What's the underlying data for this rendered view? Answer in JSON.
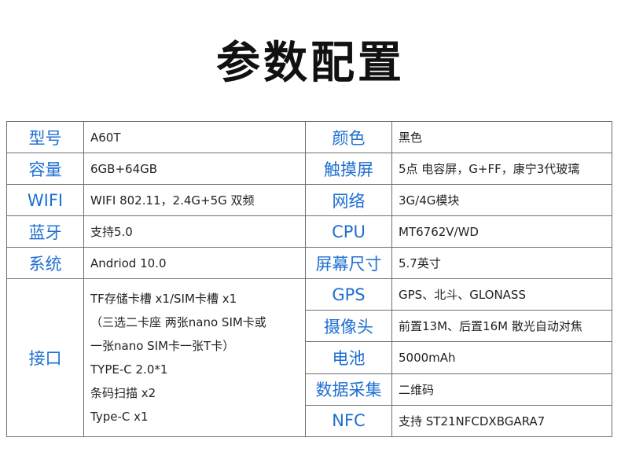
{
  "title": "参数配置",
  "rows_top": [
    {
      "k1": "型号",
      "v1": "A60T",
      "k2": "颜色",
      "v2": "黑色"
    },
    {
      "k1": "容量",
      "v1": "6GB+64GB",
      "k2": "触摸屏",
      "v2": "5点 电容屏，G+FF，康宁3代玻璃"
    },
    {
      "k1": "WIFI",
      "v1": "WIFI 802.11，2.4G+5G 双频",
      "k2": "网络",
      "v2": "3G/4G模块"
    },
    {
      "k1": "蓝牙",
      "v1": "支持5.0",
      "k2": "CPU",
      "v2": "MT6762V/WD"
    },
    {
      "k1": "系统",
      "v1": "Andriod 10.0",
      "k2": "屏幕尺寸",
      "v2": "5.7英寸"
    }
  ],
  "ports": {
    "label": "接口",
    "lines": [
      "TF存储卡槽 x1/SIM卡槽 x1",
      "（三选二卡座 两张nano SIM卡或",
      "一张nano SIM卡一张T卡）",
      "TYPE-C 2.0*1",
      "条码扫描 x2",
      "Type-C x1"
    ]
  },
  "rows_right": [
    {
      "k": "GPS",
      "v": "GPS、北斗、GLONASS"
    },
    {
      "k": "摄像头",
      "v": "前置13M、后置16M 散光自动对焦"
    },
    {
      "k": "电池",
      "v": "5000mAh"
    },
    {
      "k": "数据采集",
      "v": "二维码"
    },
    {
      "k": "NFC",
      "v": "支持 ST21NFCDXBGARA7"
    }
  ],
  "colors": {
    "key_text": "#1f6fd1",
    "border": "#6e6e6e",
    "title": "#111111"
  }
}
